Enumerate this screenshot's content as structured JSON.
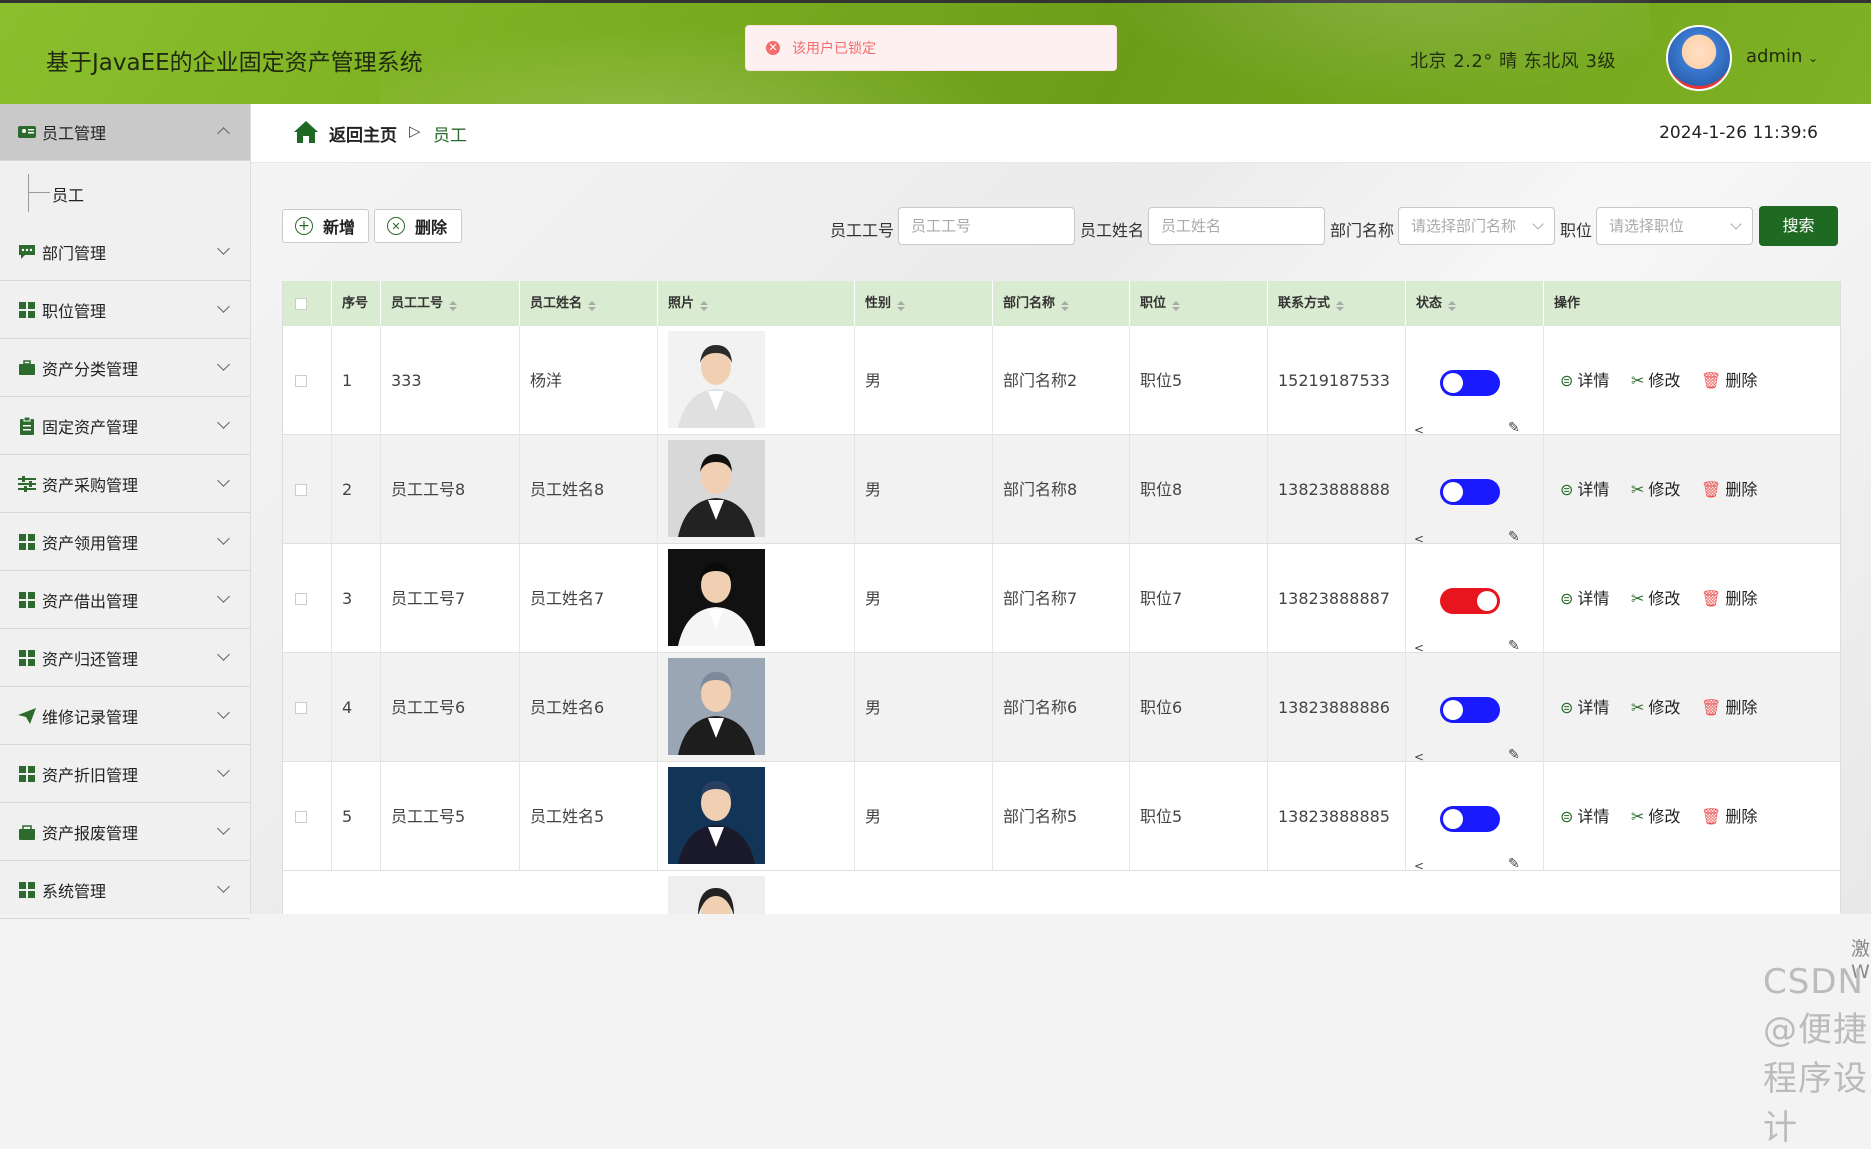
{
  "header": {
    "app_title": "基于JavaEE的企业固定资产管理系统",
    "toast": "该用户已锁定",
    "weather": "北京  2.2°  晴  东北风  3级",
    "user": "admin"
  },
  "sidebar": {
    "items": [
      {
        "label": "员工管理",
        "icon": "id-card-icon",
        "expanded": true
      },
      {
        "label": "部门管理",
        "icon": "message-icon"
      },
      {
        "label": "职位管理",
        "icon": "grid-icon"
      },
      {
        "label": "资产分类管理",
        "icon": "briefcase-icon"
      },
      {
        "label": "固定资产管理",
        "icon": "clipboard-icon"
      },
      {
        "label": "资产采购管理",
        "icon": "sliders-icon"
      },
      {
        "label": "资产领用管理",
        "icon": "grid-icon"
      },
      {
        "label": "资产借出管理",
        "icon": "grid-icon"
      },
      {
        "label": "资产归还管理",
        "icon": "grid-icon"
      },
      {
        "label": "维修记录管理",
        "icon": "paper-plane-icon"
      },
      {
        "label": "资产折旧管理",
        "icon": "grid-icon"
      },
      {
        "label": "资产报废管理",
        "icon": "bag-icon"
      },
      {
        "label": "系统管理",
        "icon": "grid-icon"
      }
    ],
    "sub_item": "员工"
  },
  "breadcrumb": {
    "home": "返回主页",
    "separator": "▷",
    "current": "员工"
  },
  "clock": "2024-1-26 11:39:6",
  "toolbar": {
    "add": "新增",
    "delete": "删除"
  },
  "filters": {
    "emp_no_label": "员工工号",
    "emp_no_placeholder": "员工工号",
    "emp_name_label": "员工姓名",
    "emp_name_placeholder": "员工姓名",
    "dept_label": "部门名称",
    "dept_placeholder": "请选择部门名称",
    "position_label": "职位",
    "position_placeholder": "请选择职位",
    "search": "搜索"
  },
  "table": {
    "headers": [
      "序号",
      "员工工号",
      "员工姓名",
      "照片",
      "性别",
      "部门名称",
      "职位",
      "联系方式",
      "状态",
      "操作"
    ],
    "rows": [
      {
        "idx": "1",
        "no": "333",
        "name": "杨洋",
        "gender": "男",
        "dept": "部门名称2",
        "pos": "职位5",
        "phone": "15219187533",
        "status_color": "#1a1aff",
        "locked": false
      },
      {
        "idx": "2",
        "no": "员工工号8",
        "name": "员工姓名8",
        "gender": "男",
        "dept": "部门名称8",
        "pos": "职位8",
        "phone": "13823888888",
        "status_color": "#1a1aff",
        "locked": false
      },
      {
        "idx": "3",
        "no": "员工工号7",
        "name": "员工姓名7",
        "gender": "男",
        "dept": "部门名称7",
        "pos": "职位7",
        "phone": "13823888887",
        "status_color": "#e8141e",
        "locked": true
      },
      {
        "idx": "4",
        "no": "员工工号6",
        "name": "员工姓名6",
        "gender": "男",
        "dept": "部门名称6",
        "pos": "职位6",
        "phone": "13823888886",
        "status_color": "#1a1aff",
        "locked": false
      },
      {
        "idx": "5",
        "no": "员工工号5",
        "name": "员工姓名5",
        "gender": "男",
        "dept": "部门名称5",
        "pos": "职位5",
        "phone": "13823888885",
        "status_color": "#1a1aff",
        "locked": false
      }
    ],
    "actions": {
      "detail": "详情",
      "edit": "修改",
      "delete": "删除"
    }
  },
  "watermark": {
    "line1": "激活 Windows",
    "line2": "CSDN @便捷程序设计"
  },
  "colors": {
    "accent": "#1e6a23",
    "header": "#7fb224",
    "thead": "#d9ebd0"
  }
}
